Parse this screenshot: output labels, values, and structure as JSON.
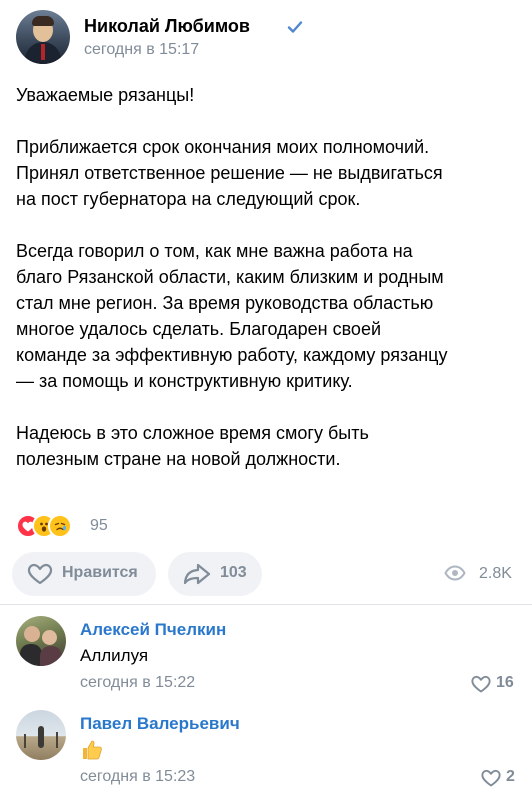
{
  "post": {
    "author": "Николай Любимов",
    "time": "сегодня в 15:17",
    "verified": true,
    "paragraphs": [
      [
        "Уважаемые рязанцы!"
      ],
      [
        "Приближается срок окончания моих полномочий.",
        "Принял ответственное решение — не выдвигаться",
        "на пост губернатора на следующий срок."
      ],
      [
        "Всегда говорил о том, как мне важна работа на",
        "благо Рязанской области, каким близким и родным",
        "стал мне регион. За время руководства областью",
        "многое удалось сделать. Благодарен своей",
        "команде за эффективную работу, каждому рязанцу",
        "— за помощь и конструктивную критику."
      ],
      [
        "Надеюсь в это сложное время смогу быть",
        "полезным стране на новой должности."
      ]
    ],
    "reactions_count": "95",
    "like_label": "Нравится",
    "share_count": "103",
    "views": "2.8K"
  },
  "comments": [
    {
      "author": "Алексей Пчелкин",
      "text": "Аллилуя",
      "time": "сегодня в 15:22",
      "likes": "16"
    },
    {
      "author": "Павел Валерьевич",
      "text": "",
      "emoji": "thumbs-up",
      "time": "сегодня в 15:23",
      "likes": "2"
    }
  ],
  "colors": {
    "link": "#2a78cc",
    "secondary": "#818c99",
    "verified": "#4f87d0",
    "button_bg": "#f0f2f5"
  },
  "icons": [
    "verified-icon",
    "heart-outline-icon",
    "share-arrow-icon",
    "eye-icon",
    "thumbs-up-icon"
  ]
}
